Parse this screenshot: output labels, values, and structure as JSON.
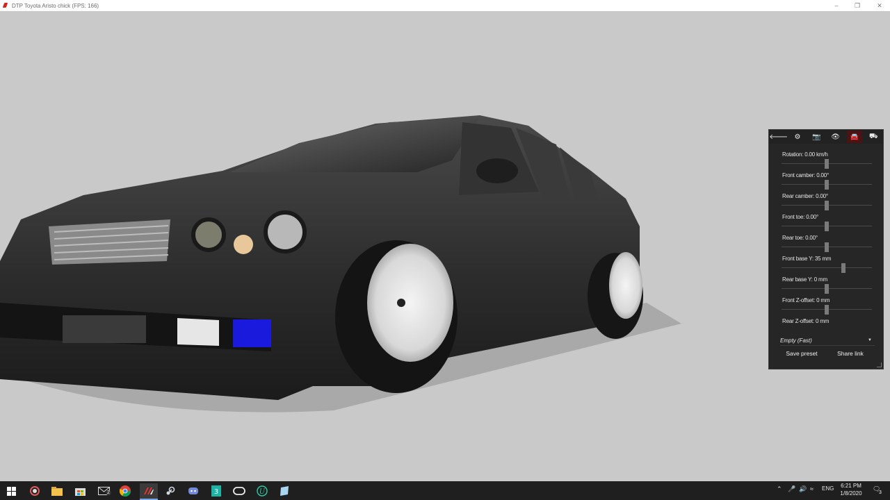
{
  "window": {
    "title": "DTP Toyota Aristo chick (FPS: 166)"
  },
  "panel": {
    "toolbar": [
      {
        "name": "back-arrow-icon",
        "glyph": "🡐"
      },
      {
        "name": "gear-icon",
        "glyph": "⚙"
      },
      {
        "name": "camera-icon",
        "glyph": "📷"
      },
      {
        "name": "eye-icon",
        "glyph": "👁"
      },
      {
        "name": "car-icon",
        "glyph": "🚘"
      },
      {
        "name": "car-edit-icon",
        "glyph": "⛟"
      }
    ],
    "sliders": [
      {
        "label": "Rotation: 0.00 km/h"
      },
      {
        "label": "Front camber: 0.00°"
      },
      {
        "label": "Rear camber: 0.00°"
      },
      {
        "label": "Front toe: 0.00°"
      },
      {
        "label": "Rear toe: 0.00°"
      },
      {
        "label": "Front base Y: 35 mm"
      },
      {
        "label": "Rear base Y: 0 mm"
      },
      {
        "label": "Front Z-offset: 0 mm"
      },
      {
        "label": "Rear Z-offset: 0 mm"
      }
    ],
    "preset": {
      "label": "Empty (Fast)"
    },
    "buttons": {
      "save": "Save preset",
      "share": "Share link"
    }
  },
  "taskbar": {
    "clock": {
      "time": "6:21 PM",
      "date": "1/8/2020"
    },
    "language": "ENG",
    "notifications": "3",
    "mail_badge": "2",
    "apps": [
      "start-icon",
      "cortana-icon",
      "file-explorer-icon",
      "store-icon",
      "mail-icon",
      "chrome-icon",
      "assetto-corsa-icon",
      "steam-icon",
      "discord-icon",
      "app-3-icon",
      "oculus-icon",
      "unity-icon",
      "notepad-icon"
    ]
  },
  "colors": {
    "accent": "#4a1414",
    "titlebar": "#ffffff",
    "taskbar": "#1f1f1f",
    "background": "#c9c9c9"
  }
}
